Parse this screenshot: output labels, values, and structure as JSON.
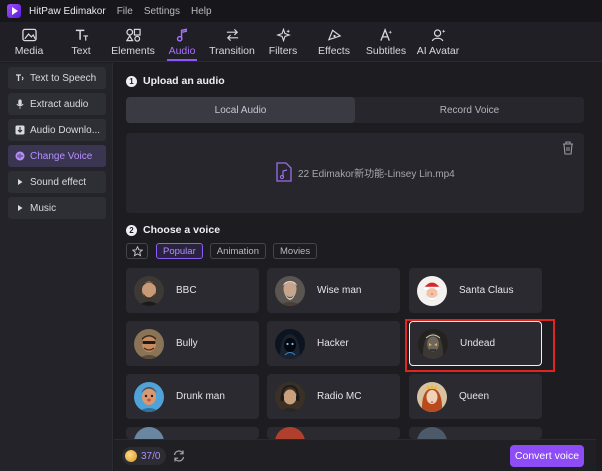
{
  "app": {
    "title": "HitPaw Edimakor",
    "menu": [
      "File",
      "Settings",
      "Help"
    ]
  },
  "toolbar": {
    "tools": [
      {
        "label": "Media",
        "icon": "media-icon"
      },
      {
        "label": "Text",
        "icon": "text-icon"
      },
      {
        "label": "Elements",
        "icon": "elements-icon"
      },
      {
        "label": "Audio",
        "icon": "audio-icon",
        "active": true
      },
      {
        "label": "Transition",
        "icon": "transition-icon"
      },
      {
        "label": "Filters",
        "icon": "filters-icon"
      },
      {
        "label": "Effects",
        "icon": "effects-icon"
      },
      {
        "label": "Subtitles",
        "icon": "subtitles-icon"
      },
      {
        "label": "AI Avatar",
        "icon": "ai-avatar-icon"
      }
    ]
  },
  "sidebar": {
    "items": [
      {
        "label": "Text to Speech",
        "icon": "text-speech-icon"
      },
      {
        "label": "Extract audio",
        "icon": "microphone-icon"
      },
      {
        "label": "Audio Downlo...",
        "icon": "download-icon"
      },
      {
        "label": "Change Voice",
        "icon": "change-voice-icon",
        "active": true
      },
      {
        "label": "Sound effect",
        "icon": "triangle-right-icon"
      },
      {
        "label": "Music",
        "icon": "triangle-right-icon"
      }
    ]
  },
  "upload": {
    "step": "1",
    "title": "Upload an audio",
    "tabs": [
      "Local Audio",
      "Record Voice"
    ],
    "file_name": "22 Edimakor新功能-Linsey Lin.mp4"
  },
  "voice": {
    "step": "2",
    "title": "Choose a voice",
    "filters": [
      "Popular",
      "Animation",
      "Movies"
    ],
    "active_filter": "Popular",
    "cards": [
      {
        "label": "BBC",
        "avatar": "man-beard-portrait"
      },
      {
        "label": "Wise man",
        "avatar": "old-man-portrait"
      },
      {
        "label": "Santa Claus",
        "avatar": "santa-portrait"
      },
      {
        "label": "Bully",
        "avatar": "bully-portrait"
      },
      {
        "label": "Hacker",
        "avatar": "hacker-portrait"
      },
      {
        "label": "Undead",
        "avatar": "undead-portrait",
        "selected": true
      },
      {
        "label": "Drunk man",
        "avatar": "drunk-man-portrait"
      },
      {
        "label": "Radio MC",
        "avatar": "radio-mc-portrait"
      },
      {
        "label": "Queen",
        "avatar": "queen-portrait"
      }
    ]
  },
  "bottom": {
    "credits": "37/0",
    "convert_label": "Convert voice"
  },
  "colors": {
    "accent": "#8d4cf5",
    "highlight": "#e0241f"
  }
}
